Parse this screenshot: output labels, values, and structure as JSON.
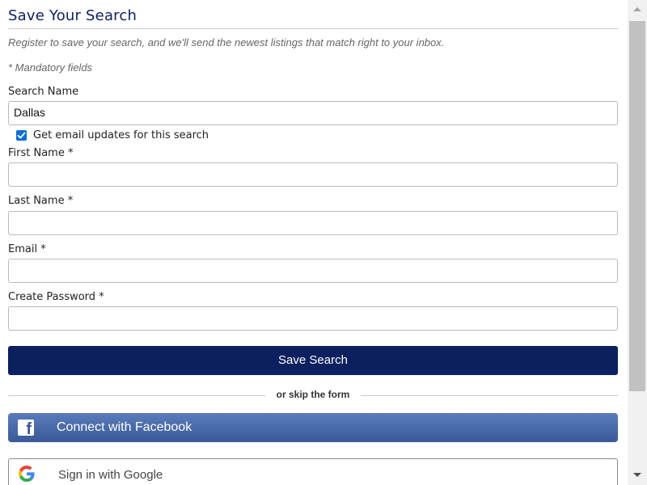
{
  "form": {
    "title": "Save Your Search",
    "subtitle": "Register to save your search, and we'll send the newest listings that match right to your inbox.",
    "mandatory_note": "* Mandatory fields",
    "search_name": {
      "label": "Search Name",
      "value": "Dallas"
    },
    "email_updates": {
      "label": "Get email updates for this search",
      "checked": true
    },
    "first_name": {
      "label": "First Name *",
      "value": ""
    },
    "last_name": {
      "label": "Last Name *",
      "value": ""
    },
    "email": {
      "label": "Email *",
      "value": ""
    },
    "password": {
      "label": "Create Password *",
      "value": ""
    },
    "submit_label": "Save Search",
    "divider_text": "or skip the form",
    "facebook_label": "Connect with Facebook",
    "google_label": "Sign in with Google"
  },
  "icons": {
    "facebook": "facebook-icon",
    "google": "google-icon",
    "checkbox": "checkmark-icon"
  },
  "colors": {
    "title": "#0f2262",
    "primary_button": "#0c1f5f",
    "facebook": "#3b5998",
    "checkbox": "#0b6fd6"
  }
}
